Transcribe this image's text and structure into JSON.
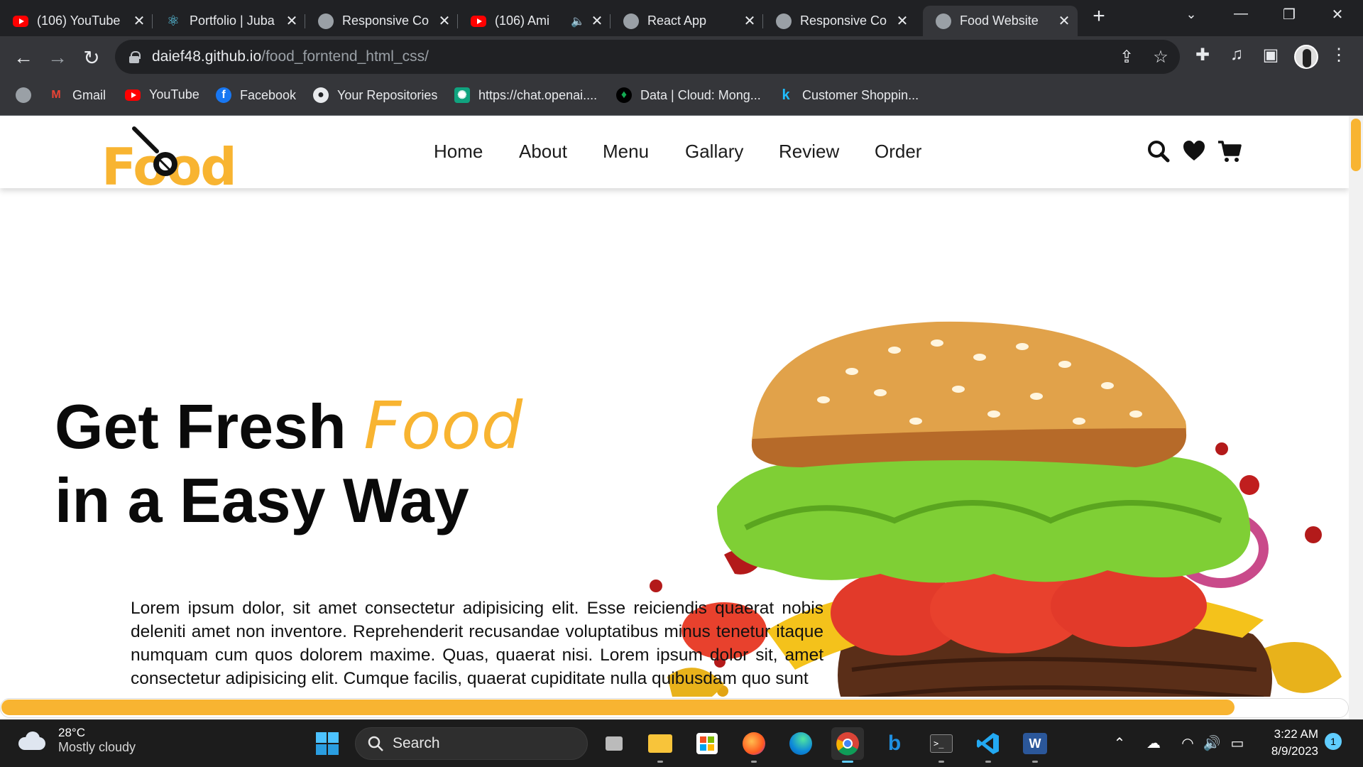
{
  "browser": {
    "tabs": [
      {
        "title": "(106) YouTube",
        "icon": "youtube-icon"
      },
      {
        "title": "Portfolio | Juba",
        "icon": "react-icon"
      },
      {
        "title": "Responsive Co",
        "icon": "globe-icon"
      },
      {
        "title": "(106) Ami",
        "icon": "youtube-icon",
        "audio": "speaker-icon"
      },
      {
        "title": "React App",
        "icon": "globe-icon"
      },
      {
        "title": "Responsive Co",
        "icon": "globe-icon"
      },
      {
        "title": "Food Website",
        "icon": "globe-icon",
        "active": true
      }
    ],
    "new_tab_label": "+",
    "address": {
      "host": "daief48.github.io",
      "path": "/food_forntend_html_css/"
    },
    "bookmarks": [
      {
        "label": "Gmail",
        "icon": "gmail-icon"
      },
      {
        "label": "YouTube",
        "icon": "youtube-icon"
      },
      {
        "label": "Facebook",
        "icon": "facebook-icon"
      },
      {
        "label": "Your Repositories",
        "icon": "github-icon"
      },
      {
        "label": "https://chat.openai....",
        "icon": "openai-icon"
      },
      {
        "label": "Data | Cloud: Mong...",
        "icon": "mongodb-icon"
      },
      {
        "label": "Customer Shoppin...",
        "icon": "kaggle-icon"
      }
    ]
  },
  "site": {
    "logo_text": "Food",
    "nav": [
      "Home",
      "About",
      "Menu",
      "Gallary",
      "Review",
      "Order"
    ],
    "hero": {
      "title_part1": "Get Fresh ",
      "title_accent": "Food",
      "title_line2": "in a Easy Way",
      "body": "Lorem ipsum dolor, sit amet consectetur adipisicing elit. Esse reiciendis quaerat nobis deleniti amet non inventore. Reprehenderit recusandae voluptatibus minus tenetur itaque numquam cum quos dolorem maxime. Quas, quaerat nisi. Lorem ipsum dolor sit, amet consectetur adipisicing elit. Cumque facilis, quaerat cupiditate nulla quibusdam quo sunt"
    },
    "accent_color": "#f8b431"
  },
  "taskbar": {
    "weather_temp": "28°C",
    "weather_desc": "Mostly cloudy",
    "search_label": "Search",
    "time": "3:22 AM",
    "date": "8/9/2023",
    "notification_count": "1"
  }
}
